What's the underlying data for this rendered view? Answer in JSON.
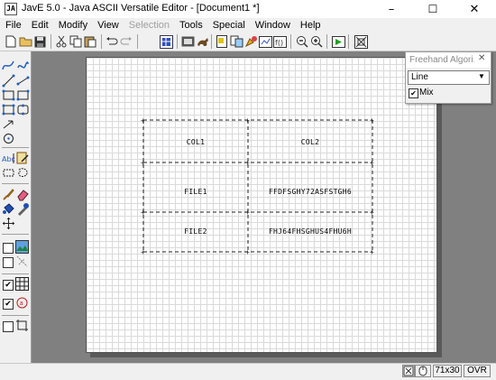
{
  "window": {
    "title": "JavE 5.0 - Java ASCII Versatile Editor - [Document1 *]",
    "app_icon_text": "JA",
    "controls": {
      "minimize": "–",
      "maximize": "☐",
      "close": "✕"
    }
  },
  "menubar": {
    "items": [
      {
        "label": "File",
        "enabled": true
      },
      {
        "label": "Edit",
        "enabled": true
      },
      {
        "label": "Modify",
        "enabled": true
      },
      {
        "label": "View",
        "enabled": true
      },
      {
        "label": "Selection",
        "enabled": false
      },
      {
        "label": "Tools",
        "enabled": true
      },
      {
        "label": "Special",
        "enabled": true
      },
      {
        "label": "Window",
        "enabled": true
      },
      {
        "label": "Help",
        "enabled": true
      }
    ]
  },
  "toolbar": {
    "icons": [
      "new-document-icon",
      "open-folder-icon",
      "save-icon",
      "cut-icon",
      "copy-icon",
      "paste-icon",
      "undo-icon",
      "redo-icon",
      "grid-tool-icon",
      "film-icon",
      "animal-icon",
      "text-format-icon",
      "clipboard-icon",
      "paint-icon",
      "thumbnail-icon",
      "function-icon",
      "zoom-out-icon",
      "zoom-in-icon",
      "play-icon",
      "bitmap-icon"
    ]
  },
  "palette": {
    "icons": [
      "freehand-curve-icon",
      "free-line-icon",
      "line-icon",
      "diagonal-line-icon",
      "rectangle-icon",
      "selection-rectangle-icon",
      "box-icon",
      "rounded-box-icon",
      "arrow-icon",
      "circle-icon",
      "text-icon",
      "note-icon",
      "select-box-icon",
      "lasso-icon",
      "brush-icon",
      "eraser-icon",
      "fill-icon",
      "color-icon",
      "move-icon",
      "image-icon",
      "transform-icon",
      "grid-icon",
      "stamp-icon",
      "crop-icon"
    ],
    "checks": [
      {
        "name": "show-image",
        "checked": false
      },
      {
        "name": "transform",
        "checked": false
      },
      {
        "name": "show-grid",
        "checked": true
      },
      {
        "name": "stamp",
        "checked": true
      },
      {
        "name": "crop",
        "checked": false
      }
    ],
    "check_mark": "✔"
  },
  "canvas": {
    "table": {
      "rows": [
        [
          "COL1",
          "COL2"
        ],
        [
          "FILE1",
          "FFDFSGHY72ASFSTGH6"
        ],
        [
          "FILE2",
          "FHJ64FHSGHUS4FHU6H"
        ]
      ]
    }
  },
  "freehand_panel": {
    "title": "Freehand Algori...",
    "close": "✕",
    "algorithm": "Line",
    "dropdown_arrow": "▼",
    "mix_label": "Mix",
    "mix_checked": true,
    "check_mark": "✔"
  },
  "statusbar": {
    "size": "71x30",
    "mode": "OVR"
  }
}
